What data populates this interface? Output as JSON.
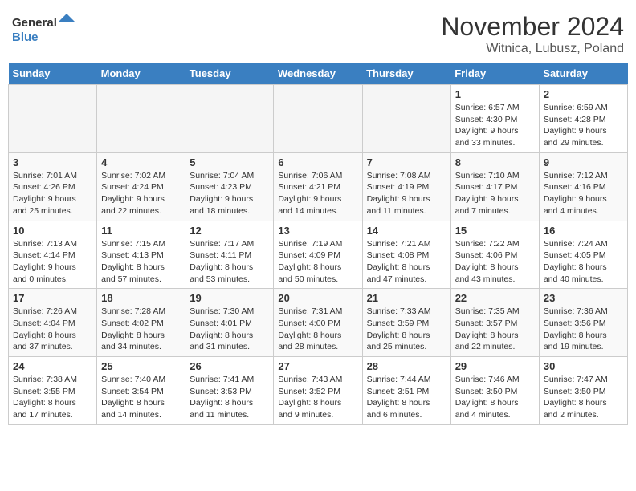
{
  "header": {
    "logo_general": "General",
    "logo_blue": "Blue",
    "month": "November 2024",
    "location": "Witnica, Lubusz, Poland"
  },
  "weekdays": [
    "Sunday",
    "Monday",
    "Tuesday",
    "Wednesday",
    "Thursday",
    "Friday",
    "Saturday"
  ],
  "weeks": [
    [
      {
        "day": "",
        "info": ""
      },
      {
        "day": "",
        "info": ""
      },
      {
        "day": "",
        "info": ""
      },
      {
        "day": "",
        "info": ""
      },
      {
        "day": "",
        "info": ""
      },
      {
        "day": "1",
        "info": "Sunrise: 6:57 AM\nSunset: 4:30 PM\nDaylight: 9 hours and 33 minutes."
      },
      {
        "day": "2",
        "info": "Sunrise: 6:59 AM\nSunset: 4:28 PM\nDaylight: 9 hours and 29 minutes."
      }
    ],
    [
      {
        "day": "3",
        "info": "Sunrise: 7:01 AM\nSunset: 4:26 PM\nDaylight: 9 hours and 25 minutes."
      },
      {
        "day": "4",
        "info": "Sunrise: 7:02 AM\nSunset: 4:24 PM\nDaylight: 9 hours and 22 minutes."
      },
      {
        "day": "5",
        "info": "Sunrise: 7:04 AM\nSunset: 4:23 PM\nDaylight: 9 hours and 18 minutes."
      },
      {
        "day": "6",
        "info": "Sunrise: 7:06 AM\nSunset: 4:21 PM\nDaylight: 9 hours and 14 minutes."
      },
      {
        "day": "7",
        "info": "Sunrise: 7:08 AM\nSunset: 4:19 PM\nDaylight: 9 hours and 11 minutes."
      },
      {
        "day": "8",
        "info": "Sunrise: 7:10 AM\nSunset: 4:17 PM\nDaylight: 9 hours and 7 minutes."
      },
      {
        "day": "9",
        "info": "Sunrise: 7:12 AM\nSunset: 4:16 PM\nDaylight: 9 hours and 4 minutes."
      }
    ],
    [
      {
        "day": "10",
        "info": "Sunrise: 7:13 AM\nSunset: 4:14 PM\nDaylight: 9 hours and 0 minutes."
      },
      {
        "day": "11",
        "info": "Sunrise: 7:15 AM\nSunset: 4:13 PM\nDaylight: 8 hours and 57 minutes."
      },
      {
        "day": "12",
        "info": "Sunrise: 7:17 AM\nSunset: 4:11 PM\nDaylight: 8 hours and 53 minutes."
      },
      {
        "day": "13",
        "info": "Sunrise: 7:19 AM\nSunset: 4:09 PM\nDaylight: 8 hours and 50 minutes."
      },
      {
        "day": "14",
        "info": "Sunrise: 7:21 AM\nSunset: 4:08 PM\nDaylight: 8 hours and 47 minutes."
      },
      {
        "day": "15",
        "info": "Sunrise: 7:22 AM\nSunset: 4:06 PM\nDaylight: 8 hours and 43 minutes."
      },
      {
        "day": "16",
        "info": "Sunrise: 7:24 AM\nSunset: 4:05 PM\nDaylight: 8 hours and 40 minutes."
      }
    ],
    [
      {
        "day": "17",
        "info": "Sunrise: 7:26 AM\nSunset: 4:04 PM\nDaylight: 8 hours and 37 minutes."
      },
      {
        "day": "18",
        "info": "Sunrise: 7:28 AM\nSunset: 4:02 PM\nDaylight: 8 hours and 34 minutes."
      },
      {
        "day": "19",
        "info": "Sunrise: 7:30 AM\nSunset: 4:01 PM\nDaylight: 8 hours and 31 minutes."
      },
      {
        "day": "20",
        "info": "Sunrise: 7:31 AM\nSunset: 4:00 PM\nDaylight: 8 hours and 28 minutes."
      },
      {
        "day": "21",
        "info": "Sunrise: 7:33 AM\nSunset: 3:59 PM\nDaylight: 8 hours and 25 minutes."
      },
      {
        "day": "22",
        "info": "Sunrise: 7:35 AM\nSunset: 3:57 PM\nDaylight: 8 hours and 22 minutes."
      },
      {
        "day": "23",
        "info": "Sunrise: 7:36 AM\nSunset: 3:56 PM\nDaylight: 8 hours and 19 minutes."
      }
    ],
    [
      {
        "day": "24",
        "info": "Sunrise: 7:38 AM\nSunset: 3:55 PM\nDaylight: 8 hours and 17 minutes."
      },
      {
        "day": "25",
        "info": "Sunrise: 7:40 AM\nSunset: 3:54 PM\nDaylight: 8 hours and 14 minutes."
      },
      {
        "day": "26",
        "info": "Sunrise: 7:41 AM\nSunset: 3:53 PM\nDaylight: 8 hours and 11 minutes."
      },
      {
        "day": "27",
        "info": "Sunrise: 7:43 AM\nSunset: 3:52 PM\nDaylight: 8 hours and 9 minutes."
      },
      {
        "day": "28",
        "info": "Sunrise: 7:44 AM\nSunset: 3:51 PM\nDaylight: 8 hours and 6 minutes."
      },
      {
        "day": "29",
        "info": "Sunrise: 7:46 AM\nSunset: 3:50 PM\nDaylight: 8 hours and 4 minutes."
      },
      {
        "day": "30",
        "info": "Sunrise: 7:47 AM\nSunset: 3:50 PM\nDaylight: 8 hours and 2 minutes."
      }
    ]
  ]
}
